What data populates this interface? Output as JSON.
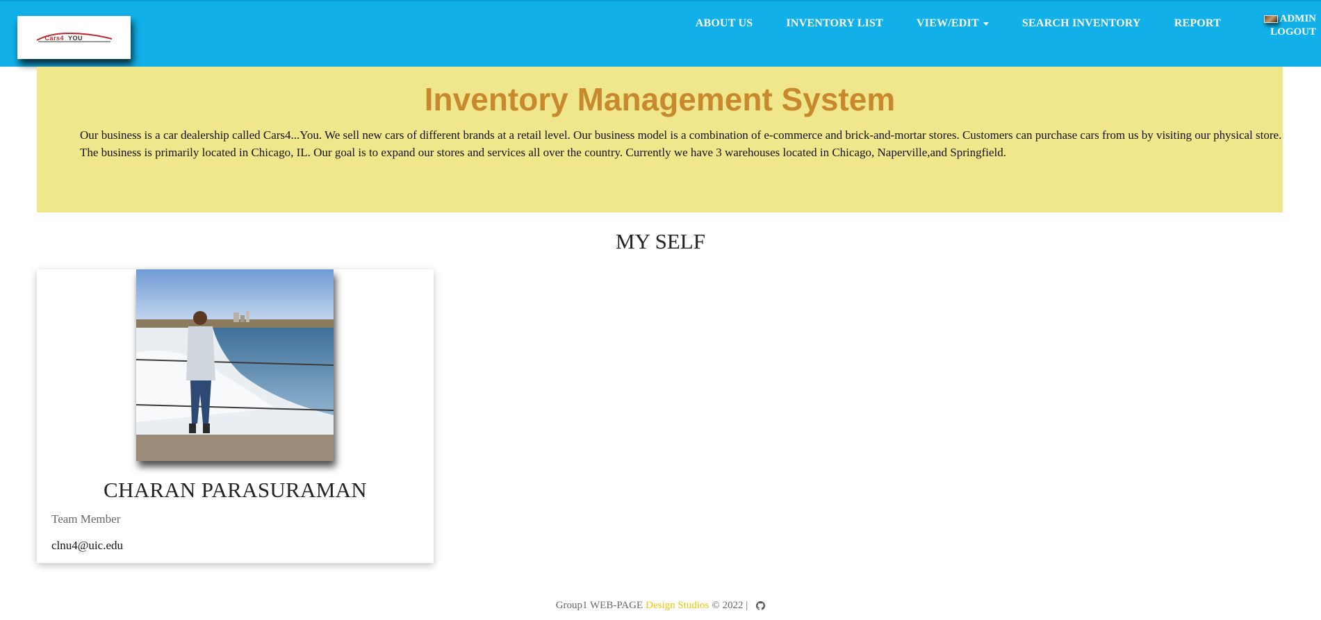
{
  "navbar": {
    "logo": {
      "brand_main": "Cars4",
      "brand_sub": "YOU"
    },
    "links": [
      {
        "label": "ABOUT US"
      },
      {
        "label": "INVENTORY LIST"
      },
      {
        "label": "VIEW/EDIT"
      },
      {
        "label": "SEARCH INVENTORY"
      },
      {
        "label": "REPORT"
      }
    ],
    "user_label": "ADMIN",
    "logout_label": "LOGOUT"
  },
  "hero": {
    "title": "Inventory Management System",
    "description": "Our business is a car dealership called Cars4...You. We sell new cars of different brands at a retail level. Our business model is a combination of e-commerce and brick-and-mortar stores. Customers can purchase cars from us by visiting our physical store. The business is primarily located in Chicago, IL. Our goal is to expand our stores and services all over the country. Currently we have 3 warehouses located in Chicago, Naperville,and Springfield."
  },
  "section": {
    "title": "MY SELF"
  },
  "member": {
    "name": "CHARAN PARASURAMAN",
    "role": "Team Member",
    "email": "clnu4@uic.edu"
  },
  "footer": {
    "prefix": "Group1 WEB-PAGE",
    "studio": "Design Studios",
    "suffix": "© 2022  |",
    "icon": "github-icon"
  },
  "colors": {
    "navbar_bg": "#12b0e8",
    "hero_bg": "#f0e68c",
    "hero_title": "#c8882e",
    "studio_text": "#f5c400"
  }
}
